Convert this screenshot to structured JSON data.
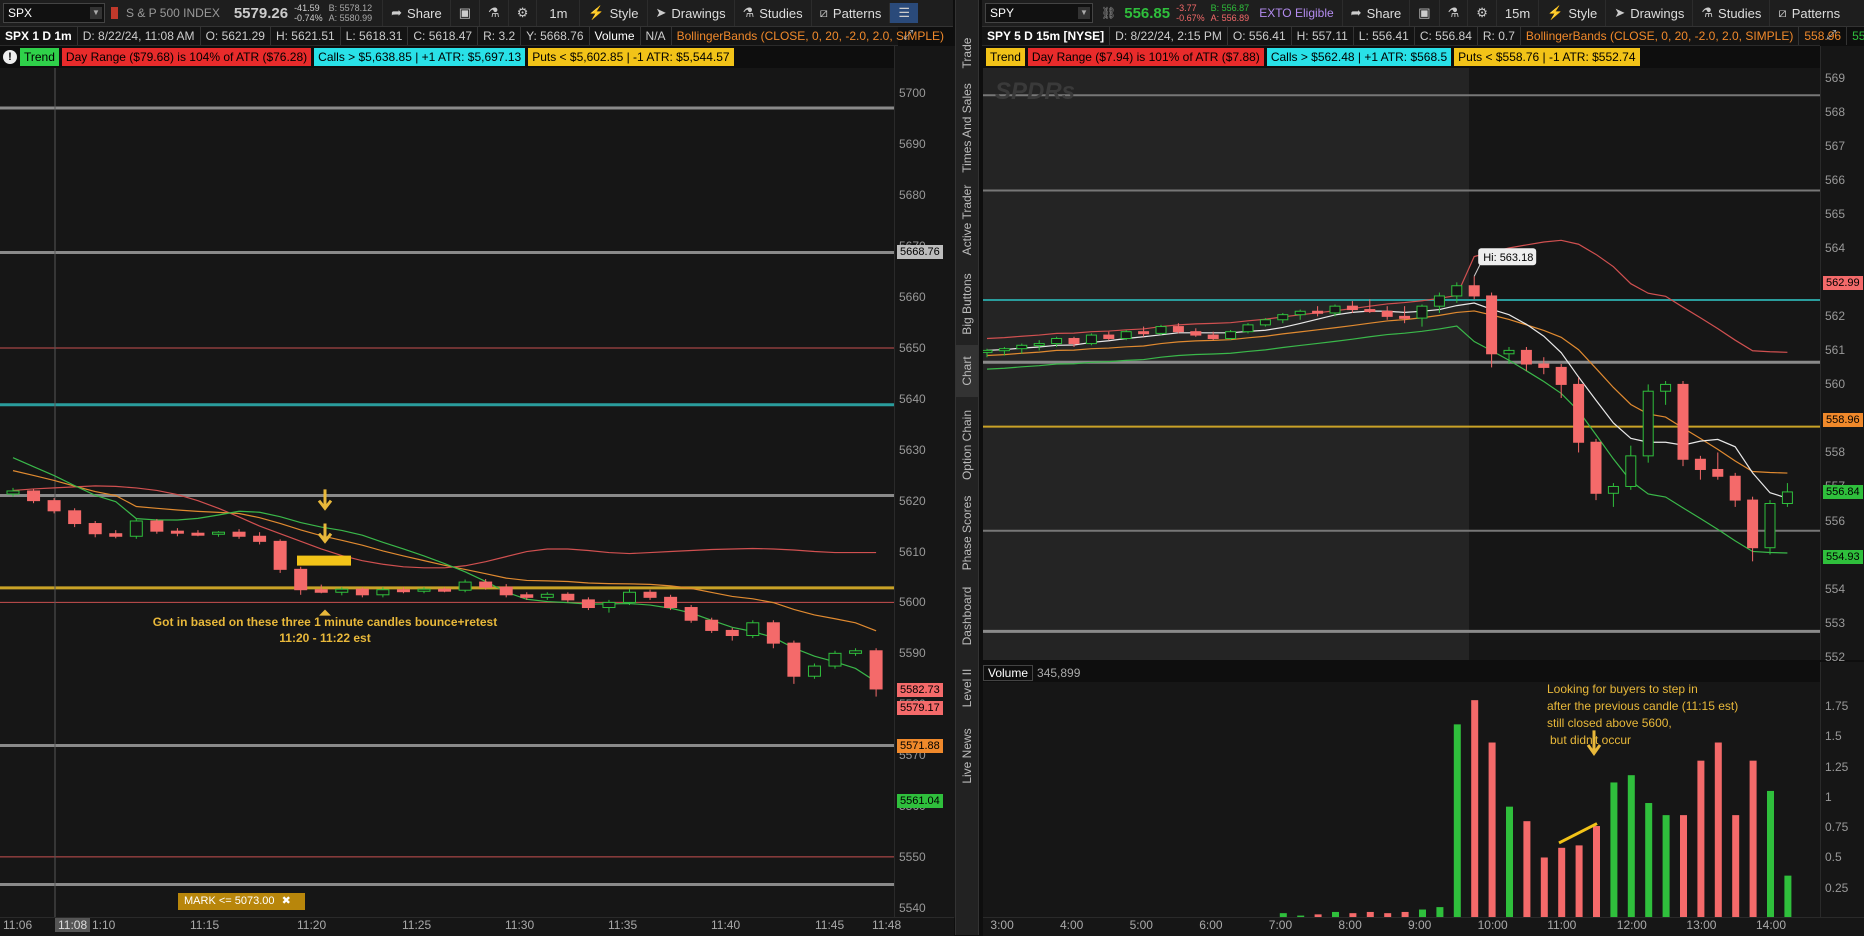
{
  "colors": {
    "up": "#2fbf3c",
    "down": "#f46a6a",
    "bg": "#161616",
    "gold": "#c9a227",
    "teal": "#2a9d9d"
  },
  "left": {
    "toolbar": {
      "symbol": "SPX",
      "index_name": "S & P 500 INDEX",
      "price": "5579.26",
      "change": "-41.59",
      "change_pct": "-0.74%",
      "bid": "B: 5578.12",
      "ask": "A: 5580.99",
      "share": "Share",
      "timeframe": "1m",
      "style": "Style",
      "drawings": "Drawings",
      "studies": "Studies",
      "patterns": "Patterns"
    },
    "info": {
      "title": "SPX 1 D 1m",
      "date": "D: 8/22/24, 11:08 AM",
      "open": "O: 5621.29",
      "high": "H: 5621.51",
      "low": "L: 5618.31",
      "close": "C: 5618.47",
      "range": "R: 3.2",
      "y": "Y: 5668.76",
      "volume": "Volume",
      "na": "N/A",
      "bb": "BollingerBands (CLOSE, 0, 20, -2.0, 2.0, SIMPLE)"
    },
    "tags": {
      "trend": "Trend",
      "day_range": "Day Range ($79.68) is 104% of ATR ($76.28)",
      "calls": "Calls > $5,638.85 | +1 ATR: $5,697.13",
      "puts": "Puts < $5,602.85 | -1 ATR: $5,544.57"
    },
    "yticks": [
      "5700",
      "5690",
      "5680",
      "5670",
      "5660",
      "5650",
      "5640",
      "5630",
      "5620",
      "5610",
      "5600",
      "5590",
      "5580",
      "5570",
      "5560",
      "5550",
      "5540"
    ],
    "price_boxes": [
      {
        "label": "5668.76",
        "color": "#bdbdbd",
        "value": 5668.76
      },
      {
        "label": "5582.73",
        "color": "#f46a6a",
        "value": 5582.73
      },
      {
        "label": "5579.17",
        "color": "#f46a6a",
        "value": 5579.17
      },
      {
        "label": "5571.88",
        "color": "#f0892b",
        "value": 5571.88
      },
      {
        "label": "5561.04",
        "color": "#2fbf3c",
        "value": 5561.04
      }
    ],
    "xticks": [
      "11:06",
      "11:08",
      "1:10",
      "11:15",
      "11:20",
      "11:25",
      "11:30",
      "11:35",
      "11:40",
      "11:45",
      "11:48"
    ],
    "annotation": "Got in based on these three 1 minute candles bounce+retest",
    "annotation_time": "11:20 - 11:22 est",
    "mark": "MARK <= 5073.00"
  },
  "right": {
    "toolbar": {
      "symbol": "SPY",
      "price": "556.85",
      "change": "-3.77",
      "change_pct": "-0.67%",
      "bid": "B: 556.87",
      "ask": "A: 556.89",
      "exto": "EXTO Eligible",
      "share": "Share",
      "timeframe": "15m",
      "style": "Style",
      "drawings": "Drawings",
      "studies": "Studies",
      "patterns": "Patterns"
    },
    "info": {
      "title": "SPY 5 D 15m [NYSE]",
      "date": "D: 8/22/24, 2:15 PM",
      "open": "O: 556.41",
      "high": "H: 557.11",
      "low": "L: 556.41",
      "close": "C: 556.84",
      "range": "R: 0.7",
      "bb": "BollingerBands (CLOSE, 0, 20, -2.0, 2.0, SIMPLE)",
      "bb_up": "558.96",
      "bb_low": "554.93"
    },
    "tags": {
      "trend": "Trend",
      "day_range": "Day Range ($7.94) is 101% of ATR ($7.88)",
      "calls": "Calls > $562.48 | +1 ATR: $568.5",
      "puts": "Puts < $558.76 | -1 ATR: $552.74"
    },
    "watermark": "SPDRs",
    "hi_label": "Hi: 563.18",
    "yticks": [
      "569",
      "568",
      "567",
      "566",
      "565",
      "564",
      "563",
      "562",
      "561",
      "560",
      "559",
      "558",
      "557",
      "556",
      "555",
      "554",
      "553",
      "552"
    ],
    "price_boxes": [
      {
        "label": "562.99",
        "color": "#f46a6a",
        "value": 562.99
      },
      {
        "label": "558.96",
        "color": "#f0892b",
        "value": 558.96
      },
      {
        "label": "556.84",
        "color": "#2fbf3c",
        "value": 556.84
      },
      {
        "label": "554.93",
        "color": "#2fbf3c",
        "value": 554.93
      }
    ],
    "xticks": [
      "3:00",
      "4:00",
      "5:00",
      "6:00",
      "7:00",
      "8:00",
      "9:00",
      "10:00",
      "11:00",
      "12:00",
      "13:00",
      "14:00"
    ],
    "volume_label": "Volume",
    "volume_value": "345,899",
    "vol_ticks": [
      "1.75",
      "1.5",
      "1.25",
      "1",
      "0.75",
      "0.5",
      "0.25"
    ],
    "vol_note": [
      "Looking for buyers to step in",
      "after the previous candle (11:15 est)",
      "still closed above 5600,",
      "but didn't occur"
    ]
  },
  "sidetabs": [
    "Trade",
    "Times And Sales",
    "Active Trader",
    "Big Buttons",
    "Chart",
    "Option Chain",
    "Phase Scores",
    "Dashboard",
    "Level II",
    "Live News"
  ],
  "chart_data": [
    {
      "type": "candlestick",
      "title": "SPX 1 D 1m",
      "ylim": [
        5538,
        5705
      ],
      "x": [
        "11:06",
        "11:07",
        "11:08",
        "11:09",
        "11:10",
        "11:11",
        "11:12",
        "11:13",
        "11:14",
        "11:15",
        "11:16",
        "11:17",
        "11:18",
        "11:19",
        "11:20",
        "11:21",
        "11:22",
        "11:23",
        "11:24",
        "11:25",
        "11:26",
        "11:27",
        "11:28",
        "11:29",
        "11:30",
        "11:31",
        "11:32",
        "11:33",
        "11:34",
        "11:35",
        "11:36",
        "11:37",
        "11:38",
        "11:39",
        "11:40",
        "11:41",
        "11:42",
        "11:43",
        "11:44",
        "11:45",
        "11:46",
        "11:47",
        "11:48"
      ],
      "ohlc": [
        [
          5621.3,
          5622.5,
          5620.8,
          5621.9
        ],
        [
          5621.9,
          5622.3,
          5619.5,
          5620.0
        ],
        [
          5620.0,
          5620.5,
          5617.5,
          5618.0
        ],
        [
          5618.0,
          5618.5,
          5614.8,
          5615.5
        ],
        [
          5615.5,
          5616.0,
          5612.8,
          5613.5
        ],
        [
          5613.5,
          5614.2,
          5612.6,
          5613.0
        ],
        [
          5613.0,
          5616.5,
          5612.5,
          5616.0
        ],
        [
          5616.0,
          5616.4,
          5613.5,
          5614.0
        ],
        [
          5614.0,
          5614.6,
          5613.0,
          5613.6
        ],
        [
          5613.6,
          5614.2,
          5613.0,
          5613.4
        ],
        [
          5613.4,
          5614.0,
          5612.9,
          5613.8
        ],
        [
          5613.8,
          5614.4,
          5612.5,
          5613.0
        ],
        [
          5613.0,
          5613.8,
          5611.4,
          5612.0
        ],
        [
          5612.0,
          5612.4,
          5605.8,
          5606.5
        ],
        [
          5606.5,
          5607.0,
          5601.5,
          5602.5
        ],
        [
          5602.5,
          5603.5,
          5601.8,
          5602.0
        ],
        [
          5602.0,
          5603.0,
          5601.4,
          5602.6
        ],
        [
          5602.6,
          5603.0,
          5601.0,
          5601.5
        ],
        [
          5601.5,
          5603.0,
          5601.0,
          5602.5
        ],
        [
          5602.5,
          5603.0,
          5601.8,
          5602.2
        ],
        [
          5602.2,
          5603.0,
          5601.8,
          5602.6
        ],
        [
          5602.6,
          5603.0,
          5602.0,
          5602.4
        ],
        [
          5602.4,
          5604.5,
          5602.0,
          5604.0
        ],
        [
          5604.0,
          5604.6,
          5602.5,
          5603.0
        ],
        [
          5603.0,
          5603.6,
          5601.0,
          5601.5
        ],
        [
          5601.5,
          5602.0,
          5600.5,
          5601.0
        ],
        [
          5601.0,
          5602.0,
          5600.5,
          5601.6
        ],
        [
          5601.6,
          5602.0,
          5600.0,
          5600.5
        ],
        [
          5600.5,
          5601.0,
          5598.5,
          5599.0
        ],
        [
          5599.0,
          5600.5,
          5598.0,
          5600.0
        ],
        [
          5600.0,
          5602.6,
          5599.5,
          5602.0
        ],
        [
          5602.0,
          5602.5,
          5600.5,
          5601.0
        ],
        [
          5601.0,
          5601.5,
          5598.5,
          5599.0
        ],
        [
          5599.0,
          5599.5,
          5596.0,
          5596.5
        ],
        [
          5596.5,
          5597.0,
          5594.0,
          5594.5
        ],
        [
          5594.5,
          5595.0,
          5592.5,
          5593.5
        ],
        [
          5593.5,
          5596.5,
          5593.0,
          5596.0
        ],
        [
          5596.0,
          5596.5,
          5591.0,
          5592.0
        ],
        [
          5592.0,
          5592.5,
          5584.0,
          5585.5
        ],
        [
          5585.5,
          5588.0,
          5585.0,
          5587.5
        ],
        [
          5587.5,
          5590.5,
          5587.0,
          5590.0
        ],
        [
          5590.0,
          5591.0,
          5589.5,
          5590.5
        ],
        [
          5590.5,
          5591.0,
          5581.5,
          5583.0
        ]
      ],
      "bb_upper": [
        5622.0,
        5622.3,
        5622.5,
        5622.7,
        5622.9,
        5622.8,
        5622.5,
        5622.0,
        5621.2,
        5620.0,
        5618.5,
        5616.8,
        5615.0,
        5613.5,
        5612.0,
        5610.5,
        5609.2,
        5608.2,
        5607.5,
        5607.0,
        5606.8,
        5606.8,
        5607.2,
        5608.0,
        5609.0,
        5610.0,
        5610.5,
        5610.5,
        5610.2,
        5609.8,
        5609.6,
        5609.8,
        5610.0,
        5610.2,
        5610.4,
        5610.5,
        5610.6,
        5610.5,
        5610.3,
        5610.0,
        5609.8,
        5609.8,
        5609.8
      ]
    },
    {
      "type": "candlestick",
      "title": "SPY 5 D 15m [NYSE]",
      "ylim": [
        551.9,
        569.3
      ],
      "x": [
        "2:45",
        "3:00",
        "3:15",
        "3:30",
        "3:45",
        "4:00",
        "4:15",
        "4:30",
        "4:45",
        "5:00",
        "5:15",
        "5:30",
        "5:45",
        "6:00",
        "6:15",
        "6:30",
        "6:45",
        "7:00",
        "7:15",
        "7:30",
        "7:45",
        "8:00",
        "8:15",
        "8:30",
        "8:45",
        "9:00",
        "9:15",
        "9:30",
        "9:45",
        "10:00",
        "10:15",
        "10:30",
        "10:45",
        "11:00",
        "11:15",
        "11:30",
        "11:45",
        "12:00",
        "12:15",
        "12:30",
        "12:45",
        "13:00",
        "13:15",
        "13:30",
        "13:45",
        "14:00",
        "14:15"
      ],
      "ohlc": [
        [
          560.95,
          561.05,
          560.8,
          561.0
        ],
        [
          561.0,
          561.1,
          560.85,
          561.05
        ],
        [
          561.05,
          561.2,
          560.9,
          561.15
        ],
        [
          561.15,
          561.3,
          561.0,
          561.2
        ],
        [
          561.2,
          561.4,
          561.1,
          561.35
        ],
        [
          561.35,
          561.4,
          561.1,
          561.2
        ],
        [
          561.2,
          561.5,
          561.15,
          561.45
        ],
        [
          561.45,
          561.55,
          561.3,
          561.35
        ],
        [
          561.35,
          561.6,
          561.3,
          561.55
        ],
        [
          561.55,
          561.7,
          561.4,
          561.5
        ],
        [
          561.5,
          561.75,
          561.45,
          561.7
        ],
        [
          561.7,
          561.8,
          561.5,
          561.55
        ],
        [
          561.55,
          561.65,
          561.4,
          561.45
        ],
        [
          561.45,
          561.55,
          561.3,
          561.35
        ],
        [
          561.35,
          561.6,
          561.3,
          561.55
        ],
        [
          561.55,
          561.8,
          561.5,
          561.75
        ],
        [
          561.75,
          561.95,
          561.7,
          561.9
        ],
        [
          561.9,
          562.1,
          561.8,
          562.05
        ],
        [
          562.05,
          562.2,
          561.9,
          562.15
        ],
        [
          562.15,
          562.3,
          562.0,
          562.1
        ],
        [
          562.1,
          562.35,
          562.0,
          562.3
        ],
        [
          562.3,
          562.45,
          562.1,
          562.2
        ],
        [
          562.2,
          562.5,
          562.1,
          562.15
        ],
        [
          562.15,
          562.3,
          561.9,
          562.0
        ],
        [
          562.0,
          562.3,
          561.8,
          561.95
        ],
        [
          561.95,
          562.35,
          561.7,
          562.3
        ],
        [
          562.3,
          562.7,
          562.1,
          562.6
        ],
        [
          562.6,
          563.0,
          562.4,
          562.9
        ],
        [
          562.9,
          563.18,
          562.5,
          562.6
        ],
        [
          562.6,
          562.7,
          560.5,
          560.9
        ],
        [
          560.9,
          561.1,
          560.6,
          561.0
        ],
        [
          561.0,
          561.1,
          560.4,
          560.6
        ],
        [
          560.6,
          560.8,
          560.3,
          560.5
        ],
        [
          560.5,
          560.6,
          559.6,
          560.0
        ],
        [
          560.0,
          560.2,
          558.0,
          558.3
        ],
        [
          558.3,
          558.4,
          556.6,
          556.8
        ],
        [
          556.8,
          557.1,
          556.4,
          557.0
        ],
        [
          557.0,
          558.2,
          556.9,
          557.9
        ],
        [
          557.9,
          560.0,
          557.7,
          559.8
        ],
        [
          559.8,
          560.1,
          559.4,
          560.0
        ],
        [
          560.0,
          560.1,
          557.6,
          557.8
        ],
        [
          557.8,
          557.9,
          557.2,
          557.5
        ],
        [
          557.5,
          558.0,
          557.2,
          557.3
        ],
        [
          557.3,
          557.4,
          556.4,
          556.6
        ],
        [
          556.6,
          556.7,
          554.8,
          555.2
        ],
        [
          555.2,
          556.6,
          555.0,
          556.5
        ],
        [
          556.5,
          557.1,
          556.4,
          556.84
        ]
      ],
      "vol": [
        0,
        0,
        0,
        0,
        0,
        0,
        0,
        0,
        0,
        0,
        0,
        0,
        0,
        0,
        0,
        0,
        0,
        0.04,
        0.02,
        0.03,
        0.05,
        0.04,
        0.05,
        0.04,
        0.05,
        0.07,
        0.09,
        1.6,
        1.8,
        1.45,
        0.92,
        0.8,
        0.5,
        0.58,
        0.6,
        0.76,
        1.12,
        1.18,
        0.95,
        0.85,
        0.85,
        1.3,
        1.45,
        0.85,
        1.3,
        1.05,
        0.35
      ]
    }
  ]
}
